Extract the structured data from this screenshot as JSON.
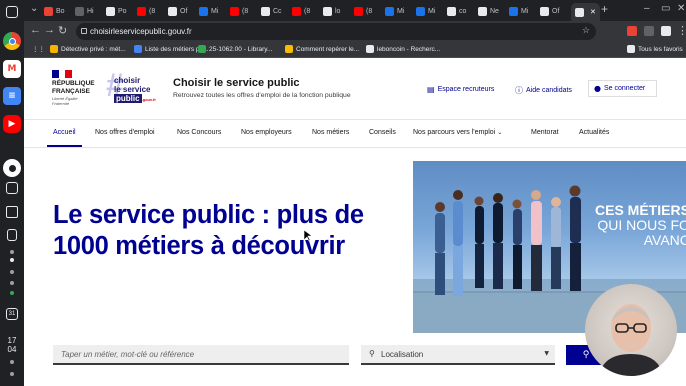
{
  "dock": {
    "time_hour": "17",
    "time_minute": "04",
    "date_badge": "31"
  },
  "browser": {
    "tabs": [
      {
        "label": "Bo",
        "color": "#ea4335"
      },
      {
        "label": "Hi",
        "color": "#5f6368"
      },
      {
        "label": "Po",
        "color": "#e8eaed"
      },
      {
        "label": "(8",
        "color": "#ff0000"
      },
      {
        "label": "Of",
        "color": "#e8eaed"
      },
      {
        "label": "Mi",
        "color": "#1a73e8"
      },
      {
        "label": "(8",
        "color": "#ff0000"
      },
      {
        "label": "Cc",
        "color": "#e8eaed"
      },
      {
        "label": "(8",
        "color": "#ff0000"
      },
      {
        "label": "lo",
        "color": "#e8eaed"
      },
      {
        "label": "(8",
        "color": "#ff0000"
      },
      {
        "label": "Mi",
        "color": "#1a73e8"
      },
      {
        "label": "Mi",
        "color": "#1a73e8"
      },
      {
        "label": "co",
        "color": "#e8eaed"
      },
      {
        "label": "Ne",
        "color": "#e8eaed"
      },
      {
        "label": "Mi",
        "color": "#1a73e8"
      },
      {
        "label": "Of",
        "color": "#e8eaed"
      },
      {
        "label": "",
        "color": "#e8eaed"
      }
    ],
    "url": "choisirleservicepublic.gouv.fr",
    "bookmarks": [
      {
        "label": "Détective privé : mét...",
        "color": "#f4b400"
      },
      {
        "label": "Liste des métiers po...",
        "color": "#4285f4"
      },
      {
        "label": "25-1062.00 - Library...",
        "color": "#34a853"
      },
      {
        "label": "Comment repérer le...",
        "color": "#fbbc05"
      },
      {
        "label": "leboncoin - Recherc...",
        "color": "#e8eaed"
      }
    ],
    "all_bookmarks": "Tous les favoris"
  },
  "header": {
    "rf_name": "RÉPUBLIQUE FRANÇAISE",
    "rf_motto": "Liberté Égalité Fraternité",
    "logo_line1": "choisir",
    "logo_line2": "le service",
    "logo_line3": "public",
    "logo_suffix": ".gouv.fr",
    "title": "Choisir le service public",
    "tagline": "Retrouvez toutes les offres d'emploi de la fonction publique",
    "recruiters": "Espace recruteurs",
    "help": "Aide candidats",
    "connect": "Se connecter"
  },
  "nav": {
    "items": [
      "Accueil",
      "Nos offres d'emploi",
      "Nos Concours",
      "Nos employeurs",
      "Nos métiers",
      "Conseils",
      "Nos parcours vers l'emploi",
      "Mentorat",
      "Actualités"
    ]
  },
  "hero": {
    "title": "Le service public : plus de 1000 métiers à découvrir",
    "banner_line1": "CES MÉTIERS",
    "banner_line2": "QUI NOUS FO",
    "banner_line3": "AVANC"
  },
  "search": {
    "placeholder": "Taper un métier, mot-clé ou référence",
    "location": "Localisation"
  }
}
